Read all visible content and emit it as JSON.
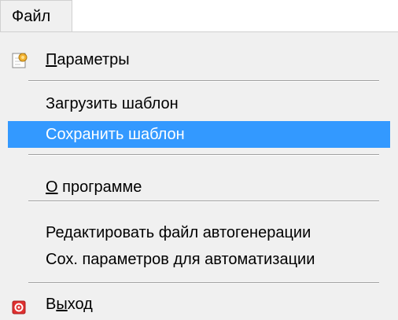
{
  "menubar": {
    "file_label": "Файл"
  },
  "menu": {
    "items": [
      {
        "label_first": "П",
        "label_rest": "араметры",
        "icon": "settings-page-icon"
      },
      {
        "label": "Загрузить шаблон"
      },
      {
        "label": "Сохранить шаблон",
        "highlighted": true
      },
      {
        "label_first": "О",
        "label_rest": " программе"
      },
      {
        "label": "Редактировать файл автогенерации"
      },
      {
        "label": "Сох. параметров для автоматизации"
      },
      {
        "label_first": "В",
        "label_mid": "ы",
        "label_rest": "ход",
        "icon": "exit-icon"
      }
    ]
  },
  "colors": {
    "highlight": "#3399ff",
    "menu_bg": "#f0f0f0",
    "exit_icon": "#e03030"
  }
}
